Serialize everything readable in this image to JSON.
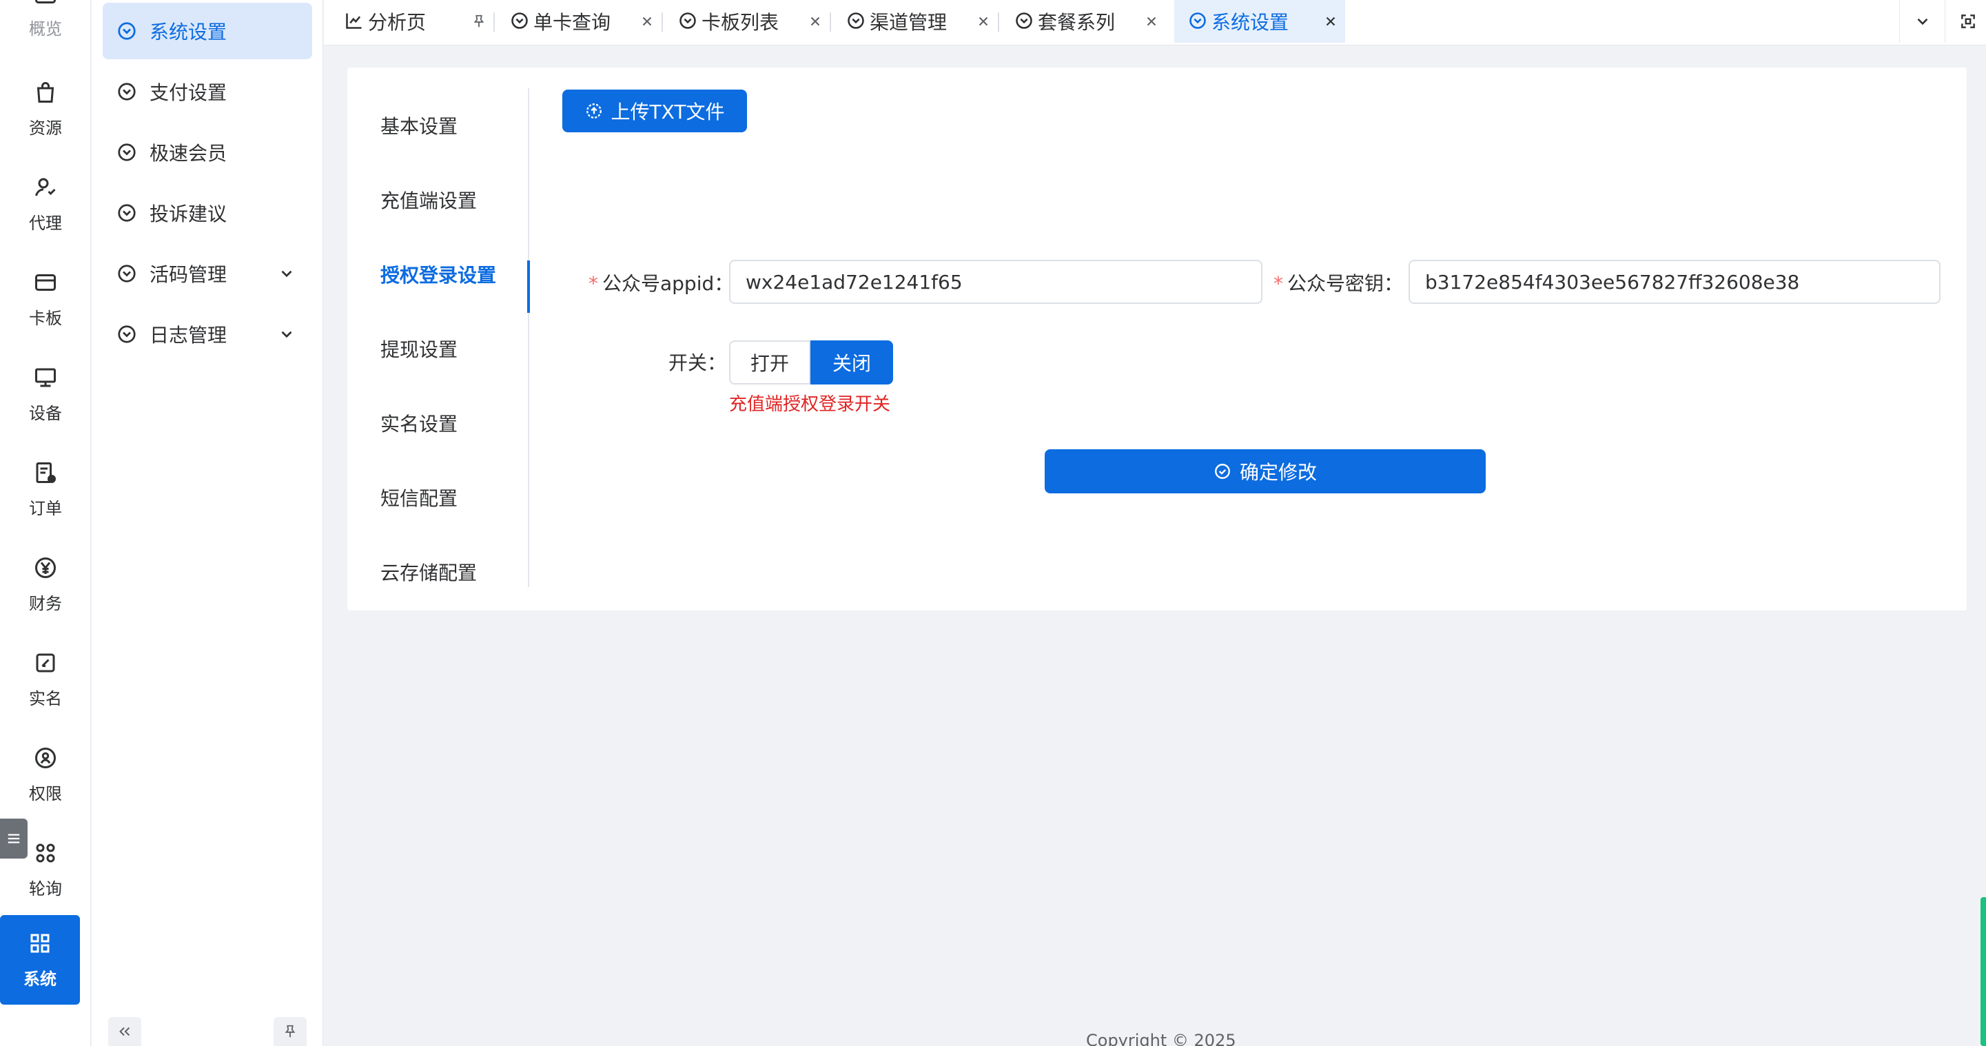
{
  "rail": {
    "items": [
      {
        "label": "概览",
        "icon": "dashboard-icon"
      },
      {
        "label": "资源",
        "icon": "bag-icon"
      },
      {
        "label": "代理",
        "icon": "agent-icon"
      },
      {
        "label": "卡板",
        "icon": "card-icon"
      },
      {
        "label": "设备",
        "icon": "monitor-icon"
      },
      {
        "label": "订单",
        "icon": "order-icon"
      },
      {
        "label": "财务",
        "icon": "yen-icon"
      },
      {
        "label": "实名",
        "icon": "edit-icon"
      },
      {
        "label": "权限",
        "icon": "shield-user-icon"
      },
      {
        "label": "轮询",
        "icon": "grid-circles-icon"
      },
      {
        "label": "系统",
        "icon": "apps-icon"
      }
    ]
  },
  "submenu": {
    "items": [
      {
        "label": "系统设置",
        "icon": "circle-chevron-down-icon"
      },
      {
        "label": "支付设置",
        "icon": "circle-chevron-down-icon"
      },
      {
        "label": "极速会员",
        "icon": "circle-chevron-down-icon"
      },
      {
        "label": "投诉建议",
        "icon": "circle-chevron-down-icon"
      },
      {
        "label": "活码管理",
        "icon": "circle-chevron-down-icon"
      },
      {
        "label": "日志管理",
        "icon": "circle-chevron-down-icon"
      }
    ]
  },
  "tabs": [
    {
      "label": "分析页",
      "icon": "chart-icon"
    },
    {
      "label": "单卡查询",
      "icon": "circle-chevron-down-icon"
    },
    {
      "label": "卡板列表",
      "icon": "circle-chevron-down-icon"
    },
    {
      "label": "渠道管理",
      "icon": "circle-chevron-down-icon"
    },
    {
      "label": "套餐系列",
      "icon": "circle-chevron-down-icon"
    },
    {
      "label": "系统设置",
      "icon": "circle-chevron-down-icon"
    }
  ],
  "settings_nav": {
    "items": [
      "基本设置",
      "充值端设置",
      "授权登录设置",
      "提现设置",
      "实名设置",
      "短信配置",
      "云存储配置"
    ]
  },
  "form": {
    "upload_label": "上传TXT文件",
    "appid_label": "公众号appid",
    "appid_value": "wx24e1ad72e1241f65",
    "secret_label": "公众号密钥",
    "secret_value": "b3172e854f4303ee567827ff32608e38",
    "switch_label": "开关",
    "switch_on": "打开",
    "switch_off": "关闭",
    "switch_selected": "关闭",
    "switch_hint": "充值端授权登录开关",
    "submit_label": "确定修改",
    "required_mark": "*",
    "colon": "："
  },
  "footer": {
    "copyright": "Copyright © 2025"
  },
  "colors": {
    "primary": "#0c6ce0",
    "danger": "#e02424",
    "required": "#f56c6c"
  }
}
